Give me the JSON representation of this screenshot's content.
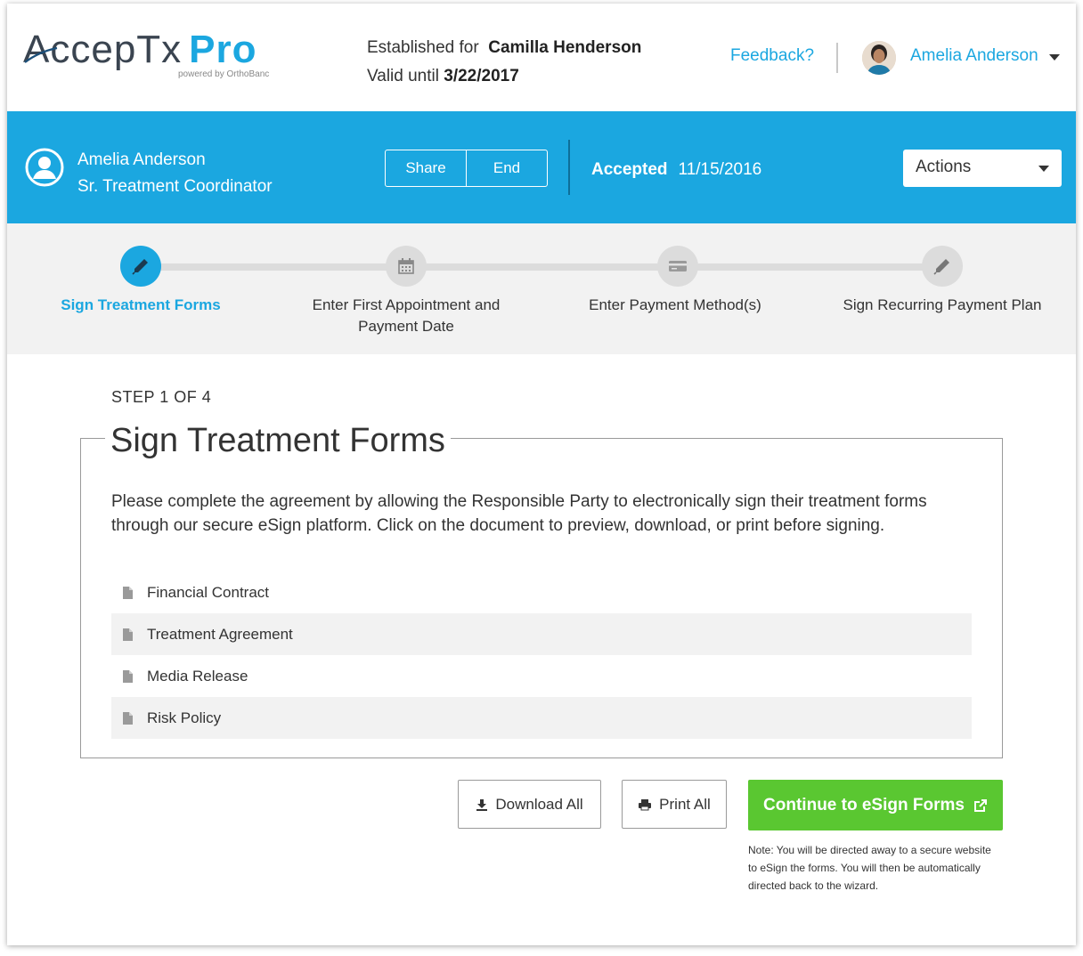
{
  "header": {
    "logo_text": "AccepTx",
    "logo_pro": "Pro",
    "logo_sub": "powered by OrthoBanc",
    "established_label": "Established for",
    "established_name": "Camilla Henderson",
    "valid_label": "Valid until",
    "valid_date": "3/22/2017",
    "feedback": "Feedback?",
    "user_name": "Amelia Anderson"
  },
  "coordinator": {
    "name": "Amelia Anderson",
    "title": "Sr. Treatment Coordinator",
    "share": "Share",
    "end": "End",
    "status_label": "Accepted",
    "status_date": "11/15/2016",
    "actions": "Actions"
  },
  "steps": [
    {
      "label_line1": "Sign Treatment Forms",
      "label_line2": "",
      "icon": "pen-icon",
      "active": true
    },
    {
      "label_line1": "Enter First Appointment and",
      "label_line2": "Payment Date",
      "icon": "calendar-icon",
      "active": false
    },
    {
      "label_line1": "Enter Payment Method(s)",
      "label_line2": "",
      "icon": "credit-card-icon",
      "active": false
    },
    {
      "label_line1": "Sign Recurring Payment Plan",
      "label_line2": "",
      "icon": "pen-icon",
      "active": false
    }
  ],
  "main": {
    "step_of": "STEP 1 OF 4",
    "title": "Sign Treatment Forms",
    "description": "Please complete the agreement by allowing the Responsible Party to electronically sign their treatment forms through our secure eSign platform. Click on the document to preview, download, or print before signing.",
    "documents": [
      "Financial Contract",
      "Treatment Agreement",
      "Media Release",
      "Risk Policy"
    ],
    "download_all": "Download All",
    "print_all": "Print All",
    "continue": "Continue to eSign Forms",
    "note": "Note: You will be directed away to a secure website to eSign the forms. You will then be automatically directed back to the wizard."
  },
  "colors": {
    "brand_blue": "#1ba7e0",
    "green": "#5ac731",
    "stepper_bg": "#f2f2f2"
  }
}
